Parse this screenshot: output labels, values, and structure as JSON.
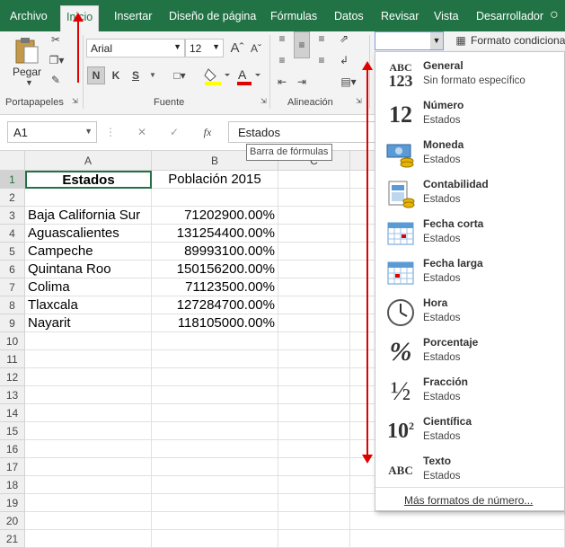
{
  "colors": {
    "excel_green": "#217346",
    "annotation_red": "#e00000"
  },
  "tabs": [
    "Archivo",
    "Inicio",
    "Insertar",
    "Diseño de página",
    "Fórmulas",
    "Datos",
    "Revisar",
    "Vista",
    "Desarrollador"
  ],
  "tab_icons": [
    "lightbulb-icon"
  ],
  "ribbon": {
    "paste_label": "Pegar",
    "clipboard_group": "Portapapeles",
    "font_name": "Arial",
    "font_size": "12",
    "bold": "N",
    "italic": "K",
    "underline": "S",
    "font_group": "Fuente",
    "alignment_group": "Alineación",
    "format_combo_value": "",
    "conditional_format": "Formato condicional"
  },
  "formula_bar": {
    "name_box": "A1",
    "fx": "fx",
    "content": "Estados",
    "tooltip": "Barra de fórmulas"
  },
  "columns": [
    "A",
    "B",
    "C"
  ],
  "rows": [
    {
      "n": "1",
      "a": "Estados",
      "b": "Población 2015"
    },
    {
      "n": "2",
      "a": "",
      "b": ""
    },
    {
      "n": "3",
      "a": "Baja California Sur",
      "b": "71202900.00%"
    },
    {
      "n": "4",
      "a": "Aguascalientes",
      "b": "131254400.00%"
    },
    {
      "n": "5",
      "a": "Campeche",
      "b": "89993100.00%"
    },
    {
      "n": "6",
      "a": "Quintana Roo",
      "b": "150156200.00%"
    },
    {
      "n": "7",
      "a": "Colima",
      "b": "71123500.00%"
    },
    {
      "n": "8",
      "a": "Tlaxcala",
      "b": "127284700.00%"
    },
    {
      "n": "9",
      "a": "Nayarit",
      "b": "118105000.00%"
    },
    {
      "n": "10",
      "a": "",
      "b": ""
    },
    {
      "n": "11",
      "a": "",
      "b": ""
    },
    {
      "n": "12",
      "a": "",
      "b": ""
    },
    {
      "n": "13",
      "a": "",
      "b": ""
    },
    {
      "n": "14",
      "a": "",
      "b": ""
    },
    {
      "n": "15",
      "a": "",
      "b": ""
    },
    {
      "n": "16",
      "a": "",
      "b": ""
    },
    {
      "n": "17",
      "a": "",
      "b": ""
    },
    {
      "n": "18",
      "a": "",
      "b": ""
    },
    {
      "n": "19",
      "a": "",
      "b": ""
    },
    {
      "n": "20",
      "a": "",
      "b": ""
    },
    {
      "n": "21",
      "a": "",
      "b": ""
    }
  ],
  "number_formats": [
    {
      "title": "General",
      "sub": "Sin formato específico",
      "icon": "general-icon",
      "glyph1": "ABC",
      "glyph2": "123"
    },
    {
      "title": "Número",
      "sub": "Estados",
      "icon": "number-icon",
      "glyph1": "12",
      "glyph2": ""
    },
    {
      "title": "Moneda",
      "sub": "Estados",
      "icon": "currency-icon",
      "glyph1": "",
      "glyph2": ""
    },
    {
      "title": "Contabilidad",
      "sub": "Estados",
      "icon": "accounting-icon",
      "glyph1": "",
      "glyph2": ""
    },
    {
      "title": "Fecha corta",
      "sub": "Estados",
      "icon": "short-date-icon",
      "glyph1": "",
      "glyph2": ""
    },
    {
      "title": "Fecha larga",
      "sub": "Estados",
      "icon": "long-date-icon",
      "glyph1": "",
      "glyph2": ""
    },
    {
      "title": "Hora",
      "sub": "Estados",
      "icon": "clock-icon",
      "glyph1": "",
      "glyph2": ""
    },
    {
      "title": "Porcentaje",
      "sub": "Estados",
      "icon": "percent-icon",
      "glyph1": "%",
      "glyph2": ""
    },
    {
      "title": "Fracción",
      "sub": "Estados",
      "icon": "fraction-icon",
      "glyph1": "½",
      "glyph2": ""
    },
    {
      "title": "Científica",
      "sub": "Estados",
      "icon": "scientific-icon",
      "glyph1": "10",
      "glyph2": "2"
    },
    {
      "title": "Texto",
      "sub": "Estados",
      "icon": "text-icon",
      "glyph1": "ABC",
      "glyph2": ""
    }
  ],
  "more_formats": "Más formatos de número..."
}
